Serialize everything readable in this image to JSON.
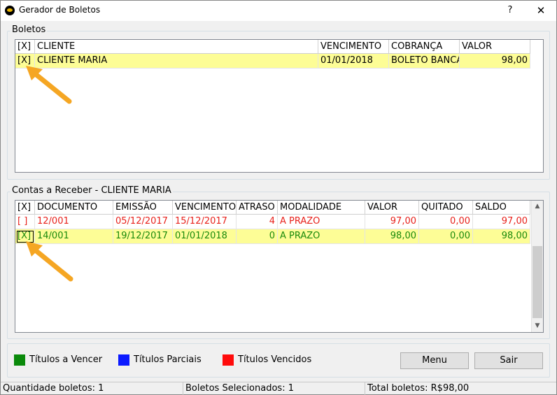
{
  "window": {
    "title": "Gerador de Boletos",
    "help_glyph": "?",
    "close_glyph": "✕"
  },
  "boletos": {
    "label": "Boletos",
    "columns": [
      "[X]",
      "CLIENTE",
      "VENCIMENTO",
      "COBRANÇA",
      "VALOR"
    ],
    "rows": [
      {
        "check": "[X]",
        "cliente": "CLIENTE MARIA",
        "vencimento": "01/01/2018",
        "cobranca": "BOLETO BANCÁRIO",
        "valor": "98,00"
      }
    ]
  },
  "contas": {
    "label": "Contas a Receber - CLIENTE MARIA",
    "columns": [
      "[X]",
      "DOCUMENTO",
      "EMISSÃO",
      "VENCIMENTO",
      "ATRASO",
      "MODALIDADE",
      "VALOR",
      "QUITADO",
      "SALDO"
    ],
    "rows": [
      {
        "check": "[ ]",
        "documento": "12/001",
        "emissao": "05/12/2017",
        "vencimento": "15/12/2017",
        "atraso": "4",
        "modalidade": "A PRAZO",
        "valor": "97,00",
        "quitado": "0,00",
        "saldo": "97,00",
        "status_color": "#e8221c"
      },
      {
        "check": "[X]",
        "documento": "14/001",
        "emissao": "19/12/2017",
        "vencimento": "01/01/2018",
        "atraso": "0",
        "modalidade": "A PRAZO",
        "valor": "98,00",
        "quitado": "0,00",
        "saldo": "98,00",
        "status_color": "#1a8a0b"
      }
    ]
  },
  "legend": [
    {
      "label": "Títulos a Vencer",
      "color": "#0a8a0a"
    },
    {
      "label": "Títulos Parciais",
      "color": "#0b1aff"
    },
    {
      "label": "Títulos Vencidos",
      "color": "#ff0b0b"
    }
  ],
  "buttons": {
    "menu": "Menu",
    "sair": "Sair"
  },
  "status": {
    "quantidade": "Quantidade boletos: 1",
    "selecionados": "Boletos Selecionados: 1",
    "total": "Total boletos: R$98,00"
  },
  "annotation_color": "#f5a623"
}
